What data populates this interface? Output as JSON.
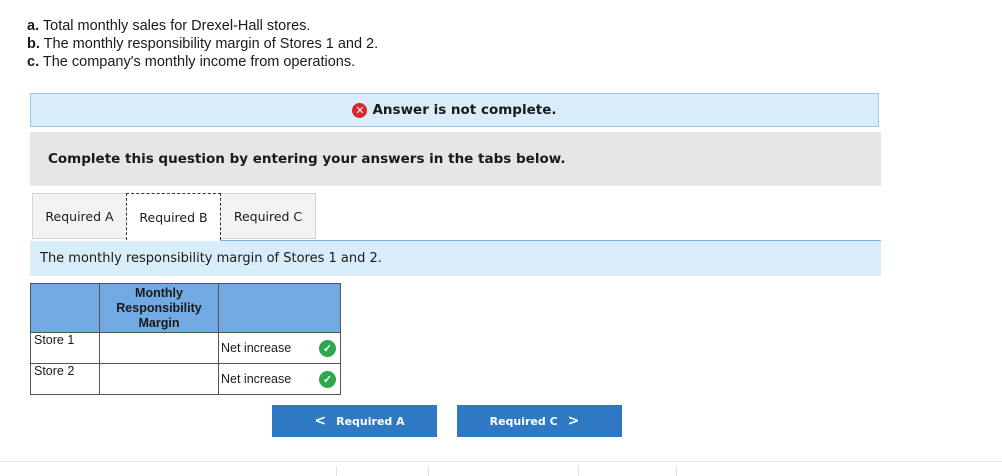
{
  "requirements": [
    {
      "letter": "a.",
      "text": "Total monthly sales for Drexel-Hall stores."
    },
    {
      "letter": "b.",
      "text": "The monthly responsibility margin of Stores 1 and 2."
    },
    {
      "letter": "c.",
      "text": "The company's monthly income from operations."
    }
  ],
  "banner": {
    "icon": "x-circle-icon",
    "text": "Answer is not complete.",
    "color": "#d9262f"
  },
  "instruction": "Complete this question by entering your answers in the tabs below.",
  "tabs": [
    {
      "label": "Required A",
      "active": false
    },
    {
      "label": "Required B",
      "active": true
    },
    {
      "label": "Required C",
      "active": false
    }
  ],
  "prompt": "The monthly responsibility margin of Stores 1 and 2.",
  "table": {
    "header": [
      "",
      "Monthly Responsibility Margin",
      ""
    ],
    "rows": [
      {
        "store": "Store 1",
        "value": "",
        "selection": "Net increase",
        "status": "correct"
      },
      {
        "store": "Store 2",
        "value": "",
        "selection": "Net increase",
        "status": "correct"
      }
    ]
  },
  "nav": {
    "prev_label": "Required A",
    "next_label": "Required C",
    "prev_arrow": "<",
    "next_arrow": ">"
  },
  "colors": {
    "accent": "#2f79c4",
    "header": "#71aae3",
    "check": "#2ea84d"
  }
}
